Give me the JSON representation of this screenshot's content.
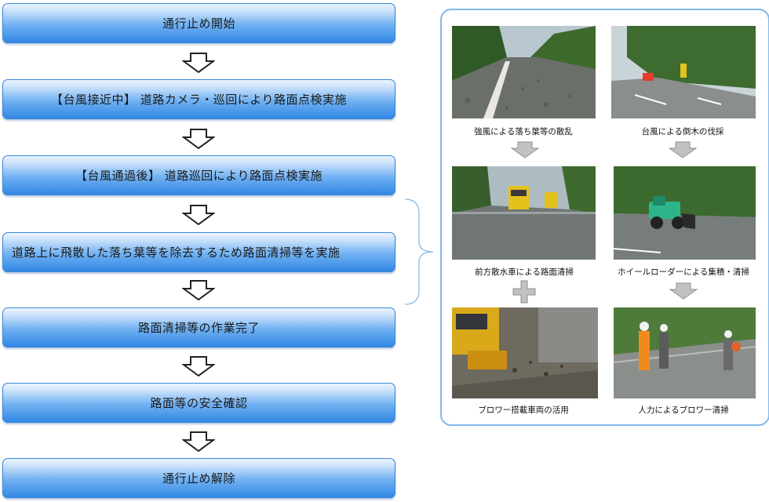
{
  "flow": {
    "steps": [
      "通行止め開始",
      "【台風接近中】 道路カメラ・巡回により路面点検実施",
      "【台風通過後】 道路巡回により路面点検実施",
      "道路上に飛散した落ち葉等を除去するため路面清掃等を実施",
      "路面清掃等の作業完了",
      "路面等の安全確認",
      "通行止め解除"
    ]
  },
  "photos": {
    "items": [
      {
        "caption": "強風による落ち葉等の散乱"
      },
      {
        "caption": "台風による倒木の伐採"
      },
      {
        "caption": "前方散水車による路面清掃"
      },
      {
        "caption": "ホイールローダーによる集積・清掃"
      },
      {
        "caption": "ブロワー搭載車両の活用"
      },
      {
        "caption": "人力によるブロワー清掃"
      }
    ]
  },
  "colors": {
    "step_fill_top": "#eef6ff",
    "step_fill_bottom": "#2f86e4",
    "panel_border": "#7fb8ec",
    "gray_arrow": "#bdbdbd"
  }
}
